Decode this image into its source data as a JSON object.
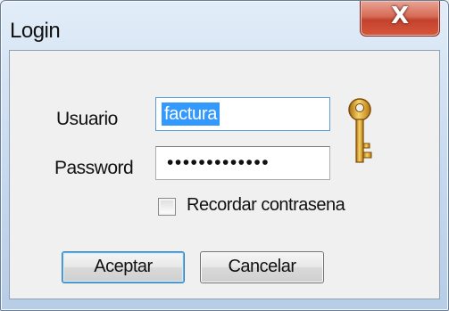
{
  "window": {
    "title": "Login",
    "close_glyph": "X"
  },
  "form": {
    "user_label": "Usuario",
    "user_value": "factura",
    "password_label": "Password",
    "password_value": "•••••••••••••",
    "remember_label": "Recordar contrasena",
    "remember_checked": false
  },
  "buttons": {
    "accept_label": "Aceptar",
    "cancel_label": "Cancelar"
  },
  "icons": {
    "key": "key-icon",
    "close": "close-icon"
  },
  "colors": {
    "selection": "#3399ff",
    "close_button": "#c2432d",
    "key_gold": "#e0a82a"
  }
}
